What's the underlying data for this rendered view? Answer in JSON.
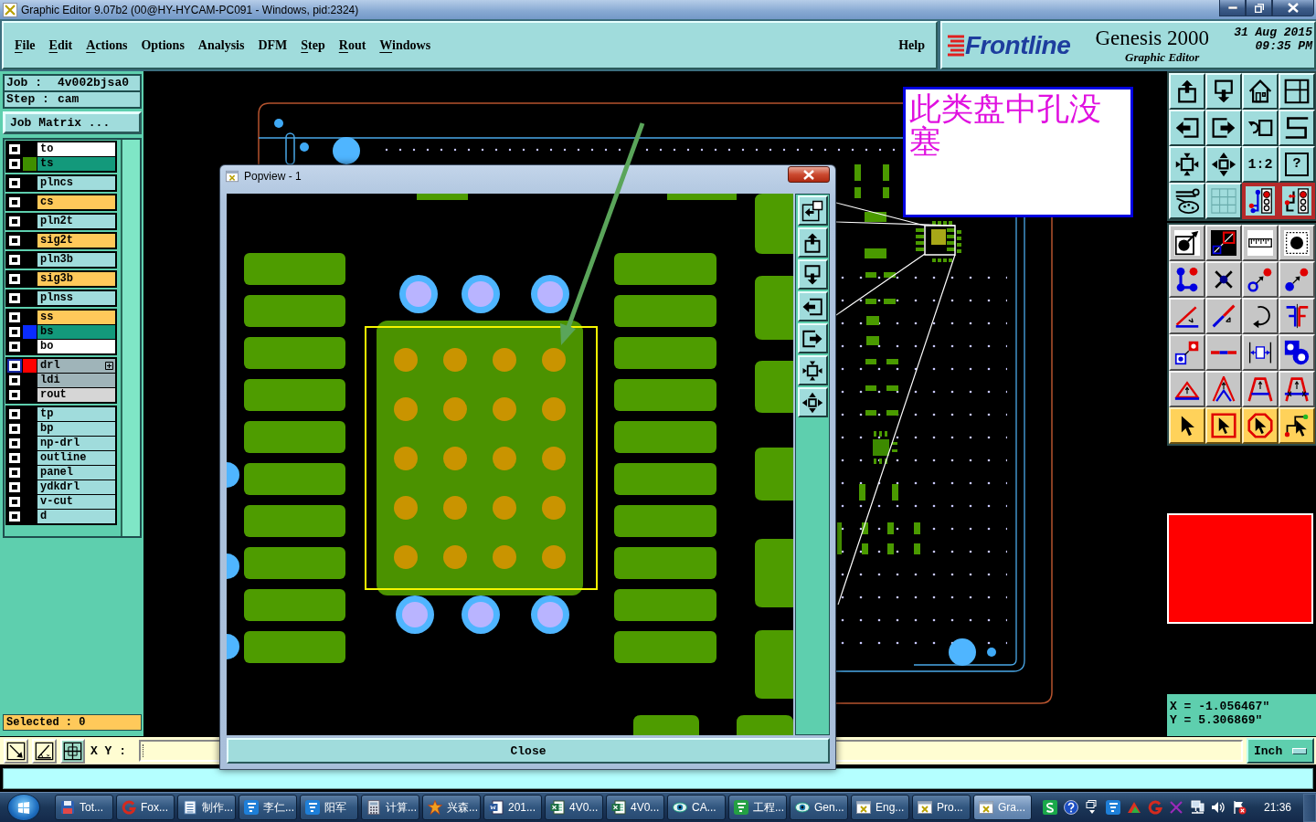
{
  "window": {
    "title": "Graphic Editor 9.07b2 (00@HY-HYCAM-PC091 - Windows, pid:2324)"
  },
  "menu": {
    "items": [
      {
        "label": "File",
        "mnemonic": true
      },
      {
        "label": "Edit",
        "mnemonic": true
      },
      {
        "label": "Actions",
        "mnemonic": true
      },
      {
        "label": "Options",
        "mnemonic": false
      },
      {
        "label": "Analysis",
        "mnemonic": false
      },
      {
        "label": "DFM",
        "mnemonic": false
      },
      {
        "label": "Step",
        "mnemonic": true
      },
      {
        "label": "Rout",
        "mnemonic": true
      },
      {
        "label": "Windows",
        "mnemonic": true
      }
    ],
    "help": "Help"
  },
  "brand": {
    "logo": "Frontline",
    "product": "Genesis 2000",
    "subtitle": "Graphic Editor",
    "date": "31 Aug 2015",
    "time": "09:35 PM"
  },
  "job_panel": {
    "job_label": "Job :",
    "job": "4v002bjsa0",
    "step_label": "Step :",
    "step": "cam",
    "matrix_button": "Job Matrix ..."
  },
  "layer_groups": [
    {
      "layers": [
        {
          "name": "to",
          "kind": "silk_screen",
          "checked": true,
          "work": false
        },
        {
          "name": "ts",
          "kind": "solder_mask",
          "color": "#3f8f00",
          "checked": true,
          "work": false
        }
      ]
    },
    {
      "layers": [
        {
          "name": "plncs",
          "kind": "power_ground",
          "checked": true,
          "work": false
        }
      ]
    },
    {
      "layers": [
        {
          "name": "cs",
          "kind": "signal",
          "checked": true,
          "work": false
        }
      ]
    },
    {
      "layers": [
        {
          "name": "pln2t",
          "kind": "power_ground",
          "checked": true,
          "work": false
        }
      ]
    },
    {
      "layers": [
        {
          "name": "sig2t",
          "kind": "signal",
          "checked": true,
          "work": false
        }
      ]
    },
    {
      "layers": [
        {
          "name": "pln3b",
          "kind": "power_ground",
          "checked": true,
          "work": false
        }
      ]
    },
    {
      "layers": [
        {
          "name": "sig3b",
          "kind": "signal",
          "checked": true,
          "work": false
        }
      ]
    },
    {
      "layers": [
        {
          "name": "plnss",
          "kind": "power_ground",
          "checked": true,
          "work": false
        }
      ]
    },
    {
      "layers": [
        {
          "name": "ss",
          "kind": "signal",
          "checked": true,
          "work": false
        },
        {
          "name": "bs",
          "kind": "solder_mask",
          "color": "#0a2cff",
          "checked": true,
          "work": false
        },
        {
          "name": "bo",
          "kind": "silk_screen",
          "checked": true,
          "work": false
        }
      ]
    },
    {
      "layers": [
        {
          "name": "drl",
          "kind": "drill",
          "color": "#ff0000",
          "checked": true,
          "work": true
        },
        {
          "name": "ldi",
          "kind": "drill",
          "checked": true,
          "work": false
        },
        {
          "name": "rout",
          "kind": "rout",
          "checked": true,
          "work": false
        }
      ]
    },
    {
      "layers": [
        {
          "name": "tp",
          "kind": "document",
          "checked": true,
          "work": false
        },
        {
          "name": "bp",
          "kind": "document",
          "checked": true,
          "work": false
        },
        {
          "name": "np-drl",
          "kind": "document",
          "checked": true,
          "work": false
        },
        {
          "name": "outline",
          "kind": "document",
          "checked": true,
          "work": false
        },
        {
          "name": "panel",
          "kind": "document",
          "checked": true,
          "work": false
        },
        {
          "name": "ydkdrl",
          "kind": "document",
          "checked": true,
          "work": false
        },
        {
          "name": "v-cut",
          "kind": "document",
          "checked": true,
          "work": false
        },
        {
          "name": "d",
          "kind": "document",
          "checked": true,
          "work": false
        }
      ]
    }
  ],
  "selected": "Selected : 0",
  "toolbar": {
    "groups": [
      {
        "tools": [
          {
            "kind": "export_up",
            "on": false
          },
          {
            "kind": "export_down",
            "on": false
          },
          {
            "kind": "home",
            "on": false
          },
          {
            "kind": "split_view",
            "on": false
          },
          {
            "kind": "import_left",
            "on": false
          },
          {
            "kind": "export_right",
            "on": false
          },
          {
            "kind": "undo_frame",
            "on": false
          },
          {
            "kind": "s_route",
            "on": false
          },
          {
            "kind": "fit_frame",
            "on": false
          },
          {
            "kind": "pan",
            "on": false
          },
          {
            "kind": "scale",
            "label": "1:2",
            "on": false
          },
          {
            "kind": "help",
            "label": "?",
            "on": false
          },
          {
            "kind": "tools_palette",
            "on": false
          },
          {
            "kind": "grid",
            "on": false
          },
          {
            "kind": "layer_connect",
            "on": true
          },
          {
            "kind": "layer_route",
            "on": true
          }
        ]
      },
      {
        "tools": [
          {
            "kind": "snap_point",
            "on": false
          },
          {
            "kind": "measure",
            "on": false
          },
          {
            "kind": "ruler",
            "on": false
          },
          {
            "kind": "center_snap",
            "on": false
          },
          {
            "kind": "node_connect",
            "on": false
          },
          {
            "kind": "node_delete",
            "on": false
          },
          {
            "kind": "link_ring",
            "on": false
          },
          {
            "kind": "link_dot",
            "on": false
          },
          {
            "kind": "angle",
            "on": false
          },
          {
            "kind": "diag_line",
            "on": false
          },
          {
            "kind": "rotate",
            "on": false
          },
          {
            "kind": "mirror",
            "on": false
          },
          {
            "kind": "move_copy",
            "on": false
          },
          {
            "kind": "line_split",
            "on": false
          },
          {
            "kind": "dimension",
            "on": false
          },
          {
            "kind": "shapes",
            "on": false
          },
          {
            "kind": "triangle_base",
            "on": false
          },
          {
            "kind": "peak",
            "on": false
          },
          {
            "kind": "arch",
            "on": false
          },
          {
            "kind": "arch_cross",
            "on": false
          },
          {
            "kind": "pointer",
            "on": false
          },
          {
            "kind": "select_box",
            "on": false
          },
          {
            "kind": "select_poly",
            "on": false
          },
          {
            "kind": "select_path",
            "on": false
          }
        ]
      }
    ]
  },
  "coordinates": {
    "x": "X = -1.056467\"",
    "y": "Y = 5.306869\""
  },
  "snap_tools": [
    {
      "kind": "resize",
      "on": false
    },
    {
      "kind": "angle",
      "on": false
    },
    {
      "kind": "grid",
      "on": true
    }
  ],
  "coordinate_entry": {
    "label": "X Y :"
  },
  "units": {
    "label": "Inch"
  },
  "note": {
    "text": "此类盘中孔没塞"
  },
  "popview": {
    "title": "Popview - 1",
    "close_button": "Close"
  },
  "taskbar": {
    "tasks": [
      {
        "label": "Tot...",
        "kind": "disk",
        "selected": false
      },
      {
        "label": "Fox...",
        "kind": "reader",
        "selected": false
      },
      {
        "label": "制作...",
        "kind": "notes",
        "selected": false
      },
      {
        "label": "李仁...",
        "kind": "app",
        "selected": false
      },
      {
        "label": "阳军",
        "kind": "app",
        "selected": false
      },
      {
        "label": "计算...",
        "kind": "calculator",
        "selected": false
      },
      {
        "label": "兴森...",
        "kind": "star",
        "selected": false
      },
      {
        "label": "201...",
        "kind": "word",
        "selected": false
      },
      {
        "label": "4V0...",
        "kind": "sheet",
        "selected": false
      },
      {
        "label": "4V0...",
        "kind": "sheet",
        "selected": false
      },
      {
        "label": "CA...",
        "kind": "viewer",
        "selected": false
      },
      {
        "label": "工程...",
        "kind": "project",
        "selected": false
      },
      {
        "label": "Gen...",
        "kind": "viewer",
        "selected": false
      },
      {
        "label": "Eng...",
        "kind": "window",
        "selected": false
      },
      {
        "label": "Pro...",
        "kind": "window",
        "selected": false
      },
      {
        "label": "Gra...",
        "kind": "window",
        "selected": true
      }
    ],
    "clock": "21:36"
  }
}
